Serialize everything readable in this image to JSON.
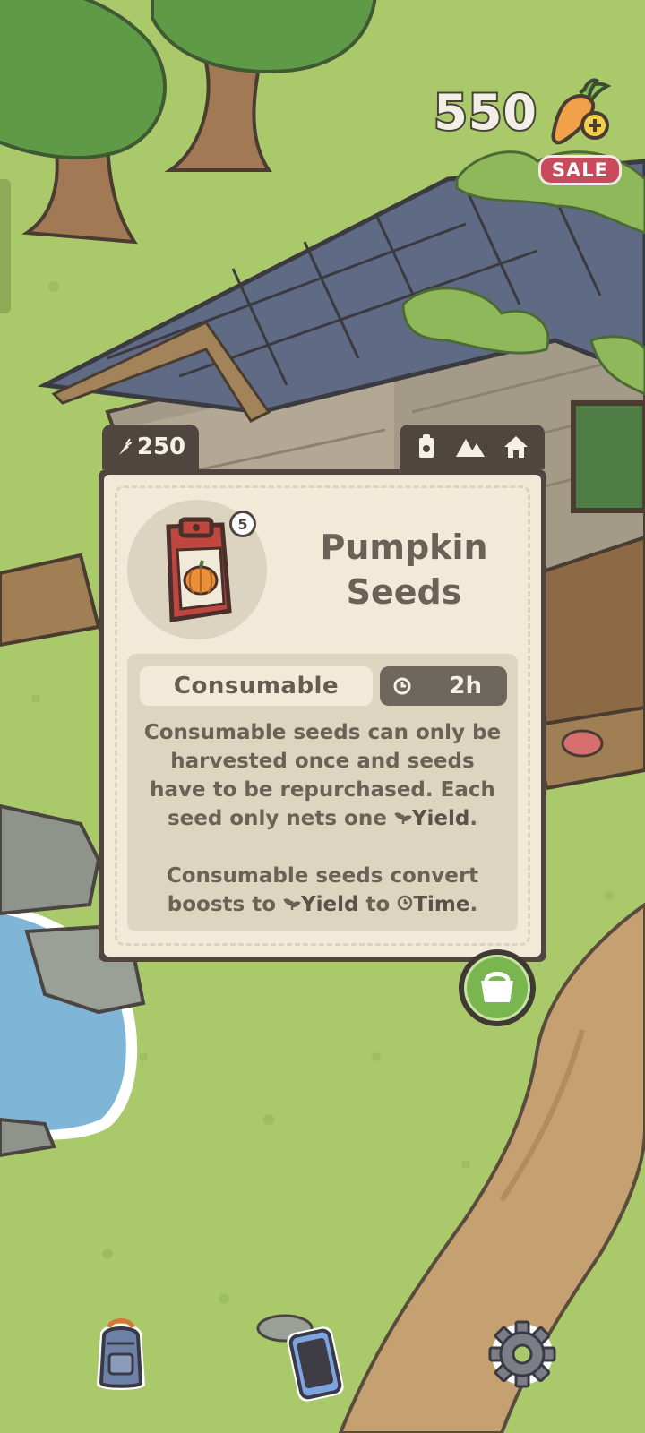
{
  "hud": {
    "carrot_balance": "550",
    "sale_label": "SALE"
  },
  "item_card": {
    "price": "250",
    "title_line1": "Pumpkin",
    "title_line2": "Seeds",
    "quantity_badge": "5",
    "type_label": "Consumable",
    "time_label": "2h",
    "description_1": "Consumable seeds can only be harvested once and seeds have to be repurchased. Each seed only nets one",
    "yield_word": "Yield",
    "description_1_end": ".",
    "description_2_a": "Consumable seeds convert boosts to",
    "description_2_b": "to",
    "time_word": "Time",
    "description_2_end": ".",
    "tab_icons": [
      "seed-packet-icon",
      "mountain-icon",
      "home-icon"
    ]
  },
  "dock": {
    "items": [
      "backpack-icon",
      "phone-icon",
      "gear-icon"
    ]
  },
  "colors": {
    "grass": "#a9c96a",
    "card_border": "#4f463f",
    "card_bg": "#f1ead8",
    "sale": "#c94a5a",
    "shop_button": "#79b64f"
  }
}
